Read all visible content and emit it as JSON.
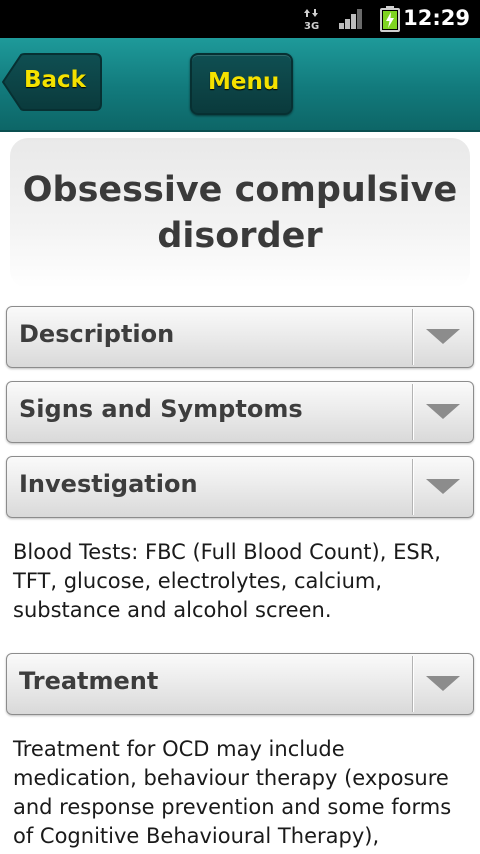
{
  "status_bar": {
    "time": "12:29",
    "network_icon": "3g-data-icon",
    "signal_icon": "signal-strength-icon",
    "battery_icon": "battery-charging-icon"
  },
  "toolbar": {
    "back_label": "Back",
    "menu_label": "Menu",
    "accent_color": "#127a7c",
    "button_text_color": "#f4e200"
  },
  "page": {
    "title": "Obsessive compulsive disorder"
  },
  "sections": [
    {
      "label": "Description",
      "expanded": false
    },
    {
      "label": "Signs and Symptoms",
      "expanded": false
    },
    {
      "label": "Investigation",
      "expanded": true,
      "content": "Blood Tests: FBC (Full Blood Count), ESR, TFT, glucose, electrolytes, calcium, substance and alcohol screen."
    },
    {
      "label": "Treatment",
      "expanded": true,
      "content": "Treatment for OCD may include medication, behaviour therapy (exposure and response prevention and some forms of Cognitive Behavioural Therapy),"
    }
  ]
}
